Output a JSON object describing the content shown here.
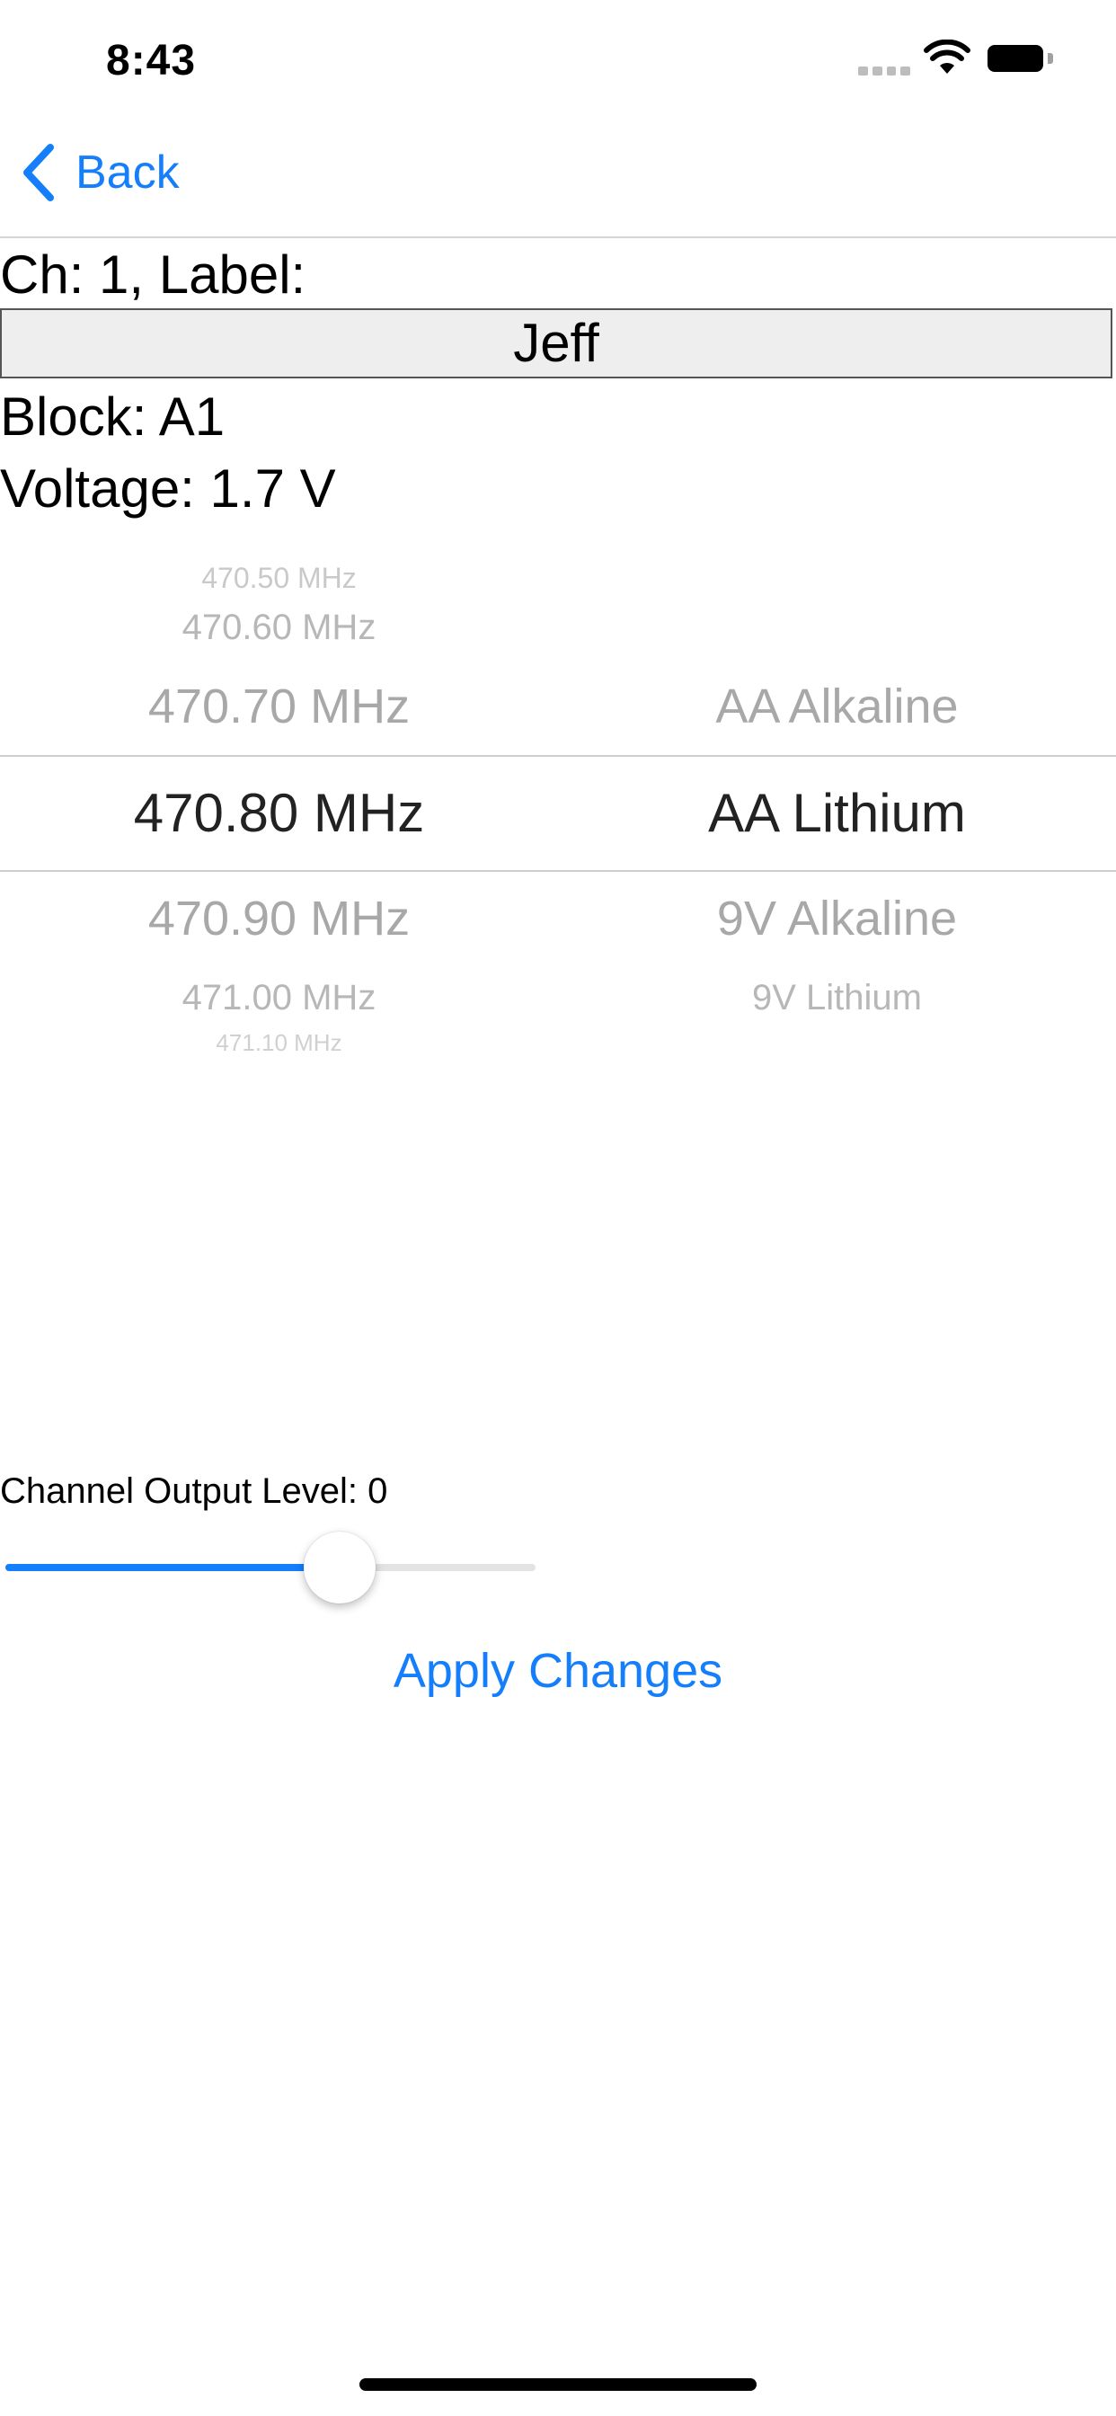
{
  "status_bar": {
    "time": "8:43",
    "icons": [
      "cellular-signal-icon",
      "wifi-icon",
      "battery-icon"
    ]
  },
  "nav": {
    "back_label": "Back",
    "back_icon": "chevron-left-icon",
    "accent_color": "#147efb"
  },
  "channel": {
    "header": "Ch: 1, Label:",
    "label_value": "Jeff",
    "block": "Block: A1",
    "voltage": "Voltage: 1.7 V"
  },
  "picker": {
    "frequency_options": [
      "470.50 MHz",
      "470.60 MHz",
      "470.70 MHz",
      "470.80 MHz",
      "470.90 MHz",
      "471.00 MHz",
      "471.10 MHz"
    ],
    "frequency_selected": "470.80 MHz",
    "battery_options": [
      "AA Alkaline",
      "AA Lithium",
      "9V Alkaline",
      "9V Lithium"
    ],
    "battery_selected": "AA Lithium"
  },
  "output": {
    "label": "Channel Output Level: 0",
    "slider_fraction": 0.63
  },
  "apply_label": "Apply Changes"
}
